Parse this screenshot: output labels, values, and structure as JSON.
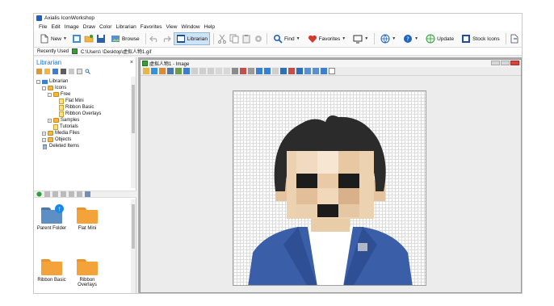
{
  "app": {
    "title": "Axialis IconWorkshop"
  },
  "menu": [
    "File",
    "Edit",
    "Image",
    "Draw",
    "Color",
    "Librarian",
    "Favorites",
    "View",
    "Window",
    "Help"
  ],
  "toolbar": {
    "new_label": "New",
    "browse_label": "Browse",
    "librarian_label": "Librarian",
    "find_label": "Find",
    "favorites_label": "Favorites",
    "update_label": "Update",
    "stock_icons_label": "Stock Icons"
  },
  "address": {
    "label": "Recently Used",
    "path": "C:\\Users\\                \\Desktop\\虚拟人物1.gif"
  },
  "librarian": {
    "title": "Librarian",
    "close": "×",
    "tree": [
      {
        "label": "Librarian"
      },
      {
        "label": "Icons"
      },
      {
        "label": "Free"
      },
      {
        "label": "Flat Mini"
      },
      {
        "label": "Ribbon Basic"
      },
      {
        "label": "Ribbon Overlays"
      },
      {
        "label": "Samples"
      },
      {
        "label": "Tutorials"
      },
      {
        "label": "Media Files"
      },
      {
        "label": "Objects"
      },
      {
        "label": "Deleted Items"
      }
    ],
    "thumbs": [
      {
        "label": "Parent Folder"
      },
      {
        "label": "Flat Mini"
      },
      {
        "label": "Ribbon Basic"
      },
      {
        "label": "Ribbon Overlays"
      }
    ]
  },
  "document": {
    "title": "虚拟人物1 - Image"
  },
  "colors": {
    "accent": "#2a73c9",
    "folder": "#f4a33a",
    "suit": "#3b5ea8"
  }
}
